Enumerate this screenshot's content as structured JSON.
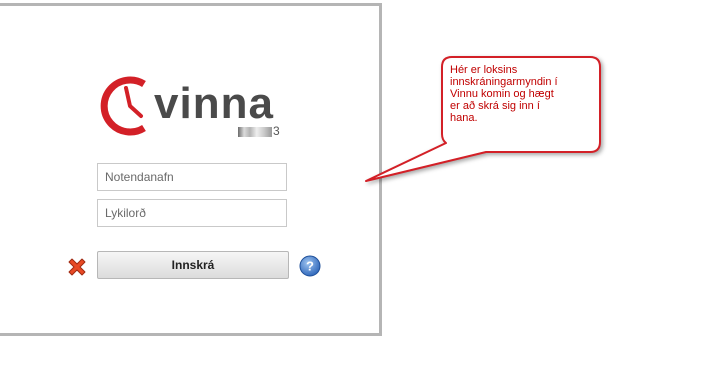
{
  "logo": {
    "brand": "vinna",
    "version_visible": "3",
    "accent_color": "#d32027",
    "icon": "clock-icon"
  },
  "login": {
    "username_placeholder": "Notendanafn",
    "password_placeholder": "Lykilorð",
    "submit_label": "Innskrá",
    "cancel_icon": "red-x-icon",
    "help_icon": "question-mark-icon"
  },
  "callout": {
    "text": "Hér er loksins\ninnskráningarmyndin í\nVinnu komin og hægt\ner að skrá sig inn í\nhana.",
    "border_color": "#d32027",
    "text_color": "#c00000"
  }
}
